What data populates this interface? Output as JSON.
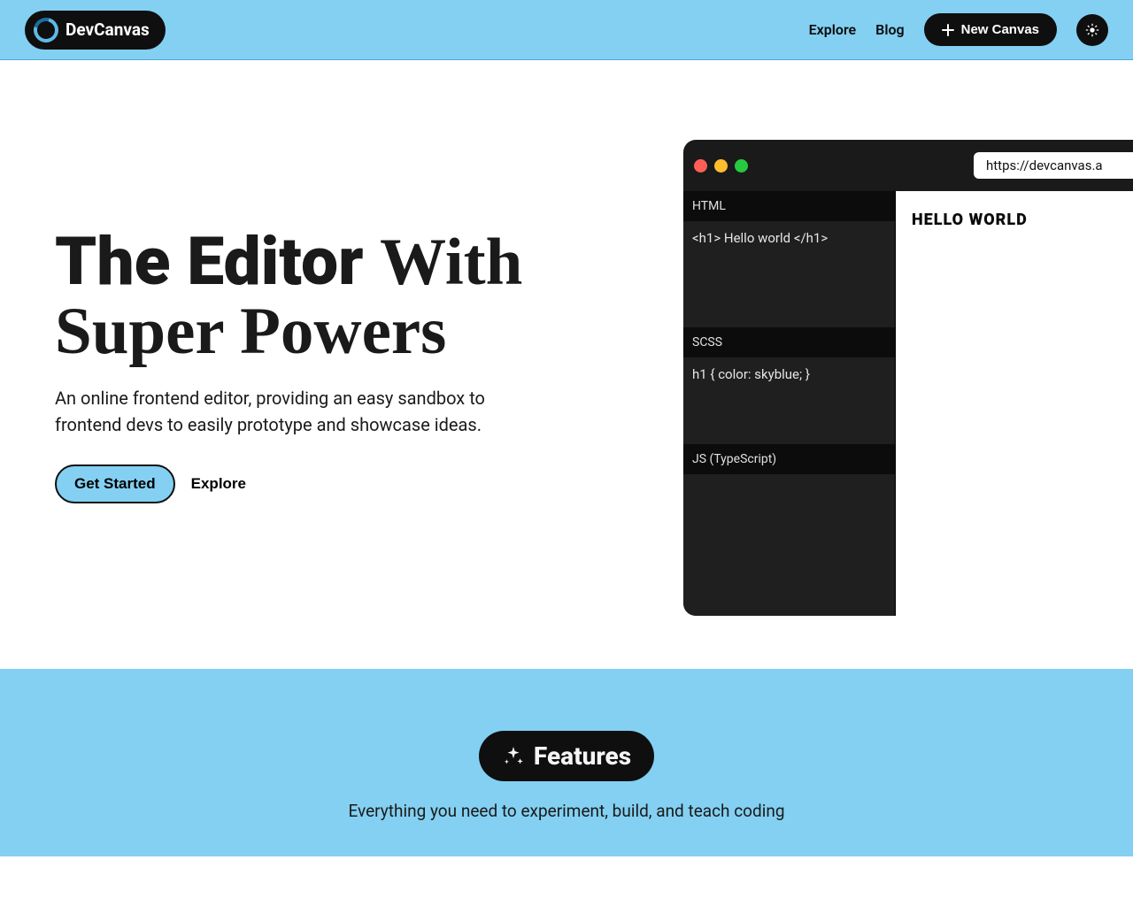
{
  "header": {
    "logo_text": "DevCanvas",
    "nav": {
      "explore": "Explore",
      "blog": "Blog",
      "new_canvas": "New Canvas"
    }
  },
  "hero": {
    "title_bold": "The Editor",
    "title_serif": "With Super Powers",
    "subtitle": "An online frontend editor, providing an easy sandbox to frontend devs to easily prototype and showcase ideas.",
    "get_started_label": "Get Started",
    "explore_label": "Explore"
  },
  "editor": {
    "url": "https://devcanvas.a",
    "panels": {
      "html": {
        "label": "HTML",
        "content": "<h1> Hello world </h1>"
      },
      "scss": {
        "label": "SCSS",
        "content": "h1 { color: skyblue; }"
      },
      "js": {
        "label": "JS (TypeScript)",
        "content": ""
      }
    },
    "preview_text": "HELLO WORLD"
  },
  "features": {
    "pill_label": "Features",
    "subtitle": "Everything you need to experiment, build, and teach coding"
  }
}
